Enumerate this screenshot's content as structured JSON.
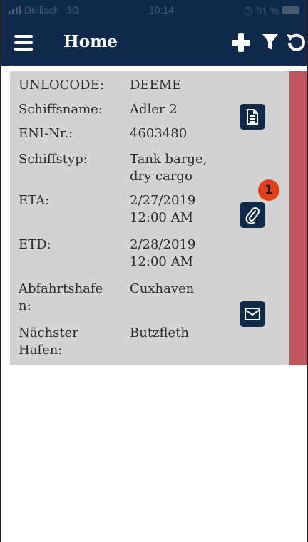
{
  "status_bar": {
    "carrier": "Drillisch",
    "network": "3G",
    "time": "10:14",
    "battery": "81 %"
  },
  "header": {
    "title": "Home"
  },
  "card": {
    "rows": [
      {
        "label": "UNLOCODE:",
        "value": "DEEME"
      },
      {
        "label": "Schiffsname:",
        "value": "Adler 2"
      },
      {
        "label": "ENI-Nr.:",
        "value": "4603480"
      },
      {
        "label": "Schiffstyp:",
        "value_lines": [
          "Tank barge,",
          "dry cargo"
        ]
      },
      {
        "label": "ETA:",
        "value_lines": [
          "2/27/2019",
          "12:00 AM"
        ]
      },
      {
        "label": "ETD:",
        "value_lines": [
          "2/28/2019",
          "12:00 AM"
        ]
      },
      {
        "label_lines": [
          "Abfahrtshafe",
          "n:"
        ],
        "value": "Cuxhaven"
      },
      {
        "label_lines": [
          "Nächster",
          "Hafen:"
        ],
        "value": "Butzfleth"
      }
    ],
    "attachment_count": "1"
  },
  "colors": {
    "header_bg": "#0f2a4a",
    "card_bg": "#d3d3d3",
    "status_strip": "#c1555b",
    "badge": "#e0411c"
  },
  "icons": {
    "menu": "hamburger-icon",
    "add": "plus-icon",
    "filter": "filter-icon",
    "refresh": "refresh-icon",
    "document": "document-icon",
    "attachment": "paperclip-icon",
    "mail": "envelope-icon"
  }
}
